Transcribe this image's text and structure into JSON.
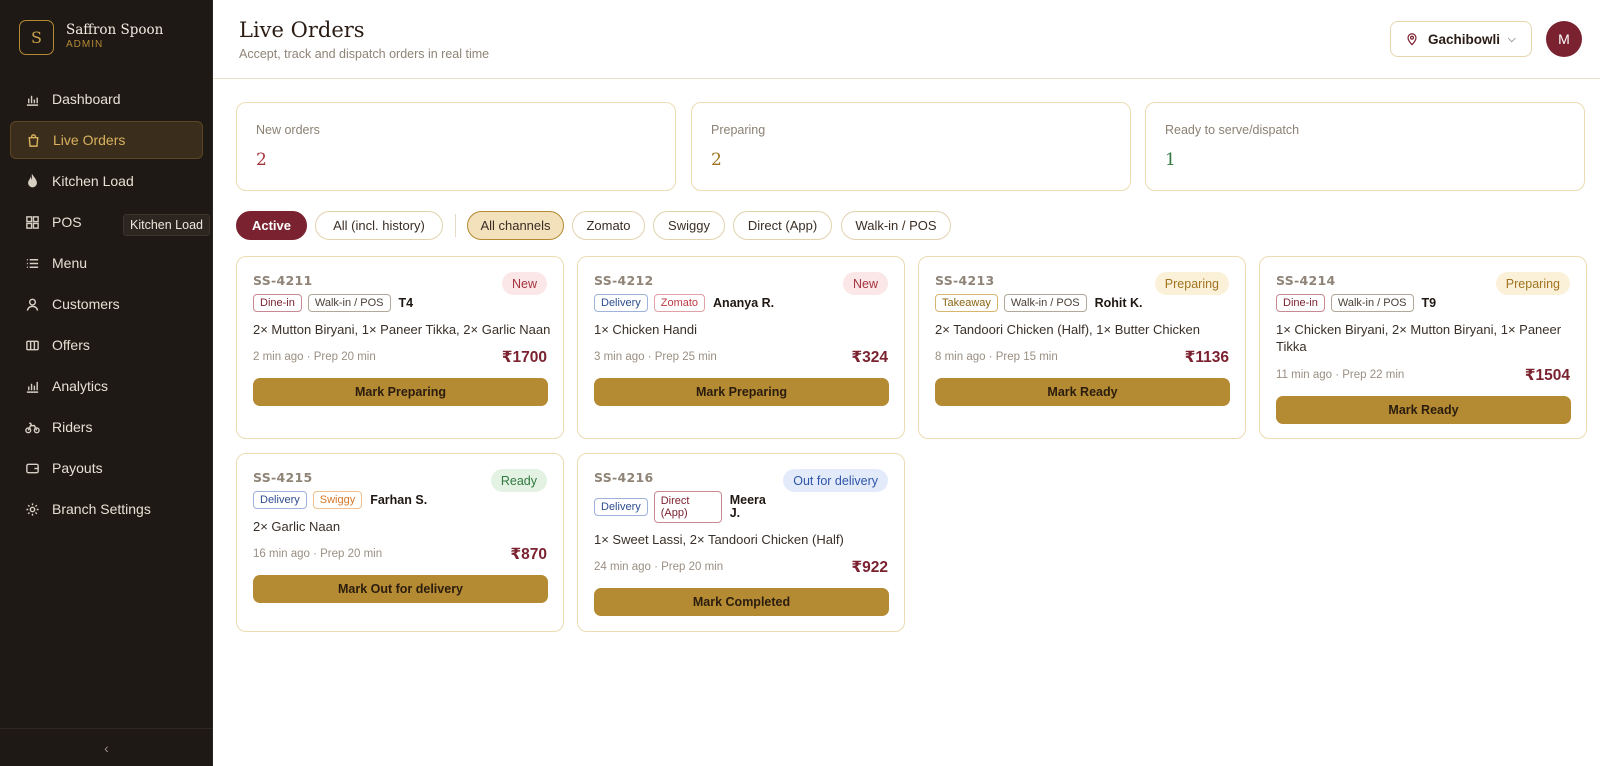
{
  "brand": {
    "logo_letter": "S",
    "name": "Saffron Spoon",
    "subtitle": "ADMIN"
  },
  "sidebar": {
    "items": [
      {
        "label": "Dashboard",
        "icon": "bar-chart-icon"
      },
      {
        "label": "Live Orders",
        "icon": "bag-icon",
        "active": true
      },
      {
        "label": "Kitchen Load",
        "icon": "flame-icon"
      },
      {
        "label": "POS",
        "icon": "grid-icon"
      },
      {
        "label": "Menu",
        "icon": "list-icon"
      },
      {
        "label": "Customers",
        "icon": "user-icon"
      },
      {
        "label": "Offers",
        "icon": "ticket-icon"
      },
      {
        "label": "Analytics",
        "icon": "analytics-icon"
      },
      {
        "label": "Riders",
        "icon": "bike-icon"
      },
      {
        "label": "Payouts",
        "icon": "wallet-icon"
      },
      {
        "label": "Branch Settings",
        "icon": "gear-icon"
      }
    ],
    "tooltip": "Kitchen Load",
    "collapse_icon": "‹"
  },
  "header": {
    "title": "Live Orders",
    "subtitle": "Accept, track and dispatch orders in real time",
    "branch": "Gachibowli",
    "avatar_initial": "M"
  },
  "stats": [
    {
      "label": "New orders",
      "value": "2",
      "color": "#a5343e"
    },
    {
      "label": "Preparing",
      "value": "2",
      "color": "#a07420"
    },
    {
      "label": "Ready to serve/dispatch",
      "value": "1",
      "color": "#2f7a3f"
    }
  ],
  "filters": {
    "status": [
      "Active",
      "All (incl. history)"
    ],
    "channels": [
      "All channels",
      "Zomato",
      "Swiggy",
      "Direct (App)",
      "Walk-in / POS"
    ]
  },
  "orders": [
    {
      "id": "SS-4211",
      "status": "New",
      "tag1": "Dine-in",
      "tag2": "Walk-in / POS",
      "who": "T4",
      "items": "2× Mutton Biryani, 1× Paneer Tikka, 2× Garlic Naan",
      "meta": "2 min ago · Prep 20 min",
      "price": "₹1700",
      "action": "Mark Preparing"
    },
    {
      "id": "SS-4212",
      "status": "New",
      "tag1": "Delivery",
      "tag2": "Zomato",
      "who": "Ananya R.",
      "items": "1× Chicken Handi",
      "meta": "3 min ago · Prep 25 min",
      "price": "₹324",
      "action": "Mark Preparing"
    },
    {
      "id": "SS-4213",
      "status": "Preparing",
      "tag1": "Takeaway",
      "tag2": "Walk-in / POS",
      "who": "Rohit K.",
      "items": "2× Tandoori Chicken (Half), 1× Butter Chicken",
      "meta": "8 min ago · Prep 15 min",
      "price": "₹1136",
      "action": "Mark Ready"
    },
    {
      "id": "SS-4214",
      "status": "Preparing",
      "tag1": "Dine-in",
      "tag2": "Walk-in / POS",
      "who": "T9",
      "items": "1× Chicken Biryani, 2× Mutton Biryani, 1× Paneer Tikka",
      "meta": "11 min ago · Prep 22 min",
      "price": "₹1504",
      "action": "Mark Ready"
    },
    {
      "id": "SS-4215",
      "status": "Ready",
      "tag1": "Delivery",
      "tag2": "Swiggy",
      "who": "Farhan S.",
      "items": "2× Garlic Naan",
      "meta": "16 min ago · Prep 20 min",
      "price": "₹870",
      "action": "Mark Out for delivery"
    },
    {
      "id": "SS-4216",
      "status": "Out for delivery",
      "tag1": "Delivery",
      "tag2": "Direct (App)",
      "who": "Meera J.",
      "items": "1× Sweet Lassi, 2× Tandoori Chicken (Half)",
      "meta": "24 min ago · Prep 20 min",
      "price": "₹922",
      "action": "Mark Completed"
    }
  ]
}
